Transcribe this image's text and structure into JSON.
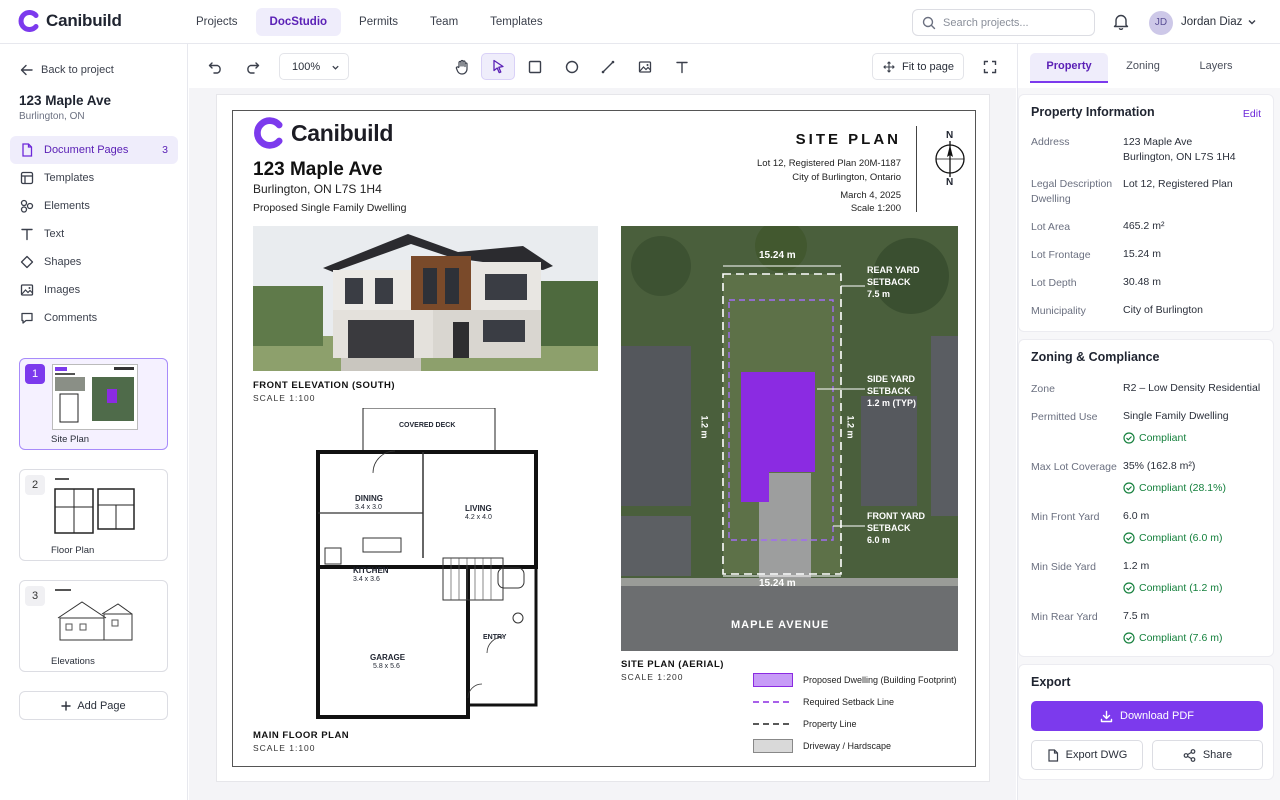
{
  "app": {
    "brand": "Canibuild"
  },
  "nav": {
    "items": [
      {
        "label": "Projects"
      },
      {
        "label": "DocStudio"
      },
      {
        "label": "Permits"
      },
      {
        "label": "Team"
      },
      {
        "label": "Templates"
      }
    ],
    "active": "DocStudio"
  },
  "search": {
    "placeholder": "Search projects..."
  },
  "user": {
    "initials": "JD",
    "name": "Jordan Diaz"
  },
  "sidebar": {
    "back_label": "Back to project",
    "project_title": "123 Maple Ave",
    "project_sub": "Burlington, ON",
    "menu": [
      {
        "label": "Document Pages",
        "count": "3",
        "icon": "document-icon"
      },
      {
        "label": "Templates",
        "icon": "template-icon"
      },
      {
        "label": "Elements",
        "icon": "elements-icon"
      },
      {
        "label": "Text",
        "icon": "text-icon"
      },
      {
        "label": "Shapes",
        "icon": "shapes-icon"
      },
      {
        "label": "Images",
        "icon": "image-icon"
      },
      {
        "label": "Comments",
        "icon": "comment-icon"
      }
    ],
    "pages": [
      {
        "num": "1",
        "label": "Site Plan"
      },
      {
        "num": "2",
        "label": "Floor Plan"
      },
      {
        "num": "3",
        "label": "Elevations"
      }
    ],
    "add_page": "Add Page"
  },
  "toolbar": {
    "zoom": "100%",
    "fit_label": "Fit to page",
    "tools": [
      "undo-icon",
      "redo-icon",
      "hand-icon",
      "select-icon",
      "rectangle-icon",
      "circle-icon",
      "line-icon",
      "image-icon",
      "text-icon",
      "fullscreen-icon"
    ]
  },
  "sheet": {
    "brand": "Canibuild",
    "address": "123 Maple Ave",
    "city": "Burlington, ON L7S 1H4",
    "desc": "Proposed Single Family Dwelling",
    "title": "SITE PLAN",
    "meta1": "Lot 12, Registered Plan 20M-1187",
    "meta2": "City of Burlington, Ontario",
    "date": "March 4, 2025",
    "scale": "Scale 1:200",
    "north": "N",
    "elev_caption": "FRONT ELEVATION (SOUTH)",
    "elev_scale": "SCALE 1:100",
    "floor_caption": "MAIN FLOOR PLAN",
    "floor_scale": "SCALE 1:100",
    "aerial_caption": "SITE PLAN (AERIAL)",
    "aerial_scale": "SCALE 1:200",
    "rooms": {
      "deck": "COVERED DECK",
      "dining": "DINING",
      "dining_dim": "3.4 x 3.0",
      "living": "LIVING",
      "living_dim": "4.2 x 4.0",
      "kitchen": "KITCHEN",
      "kitchen_dim": "3.4 x 3.6",
      "garage": "GARAGE",
      "garage_dim": "5.8 x 5.6",
      "entry": "ENTRY"
    },
    "aerial": {
      "frontage": "15.24 m",
      "frontage2": "15.24 m",
      "rear_l1": "REAR YARD",
      "rear_l2": "SETBACK",
      "rear_l3": "7.5 m",
      "side_l1": "SIDE YARD",
      "side_l2": "SETBACK",
      "side_l3": "1.2 m (TYP)",
      "front_l1": "FRONT YARD",
      "front_l2": "SETBACK",
      "front_l3": "6.0 m",
      "side_dim": "1.2 m",
      "street": "MAPLE AVENUE"
    },
    "legend": [
      {
        "label": "Proposed Dwelling (Building Footprint)"
      },
      {
        "label": "Required Setback Line"
      },
      {
        "label": "Property Line"
      },
      {
        "label": "Driveway / Hardscape"
      }
    ]
  },
  "right": {
    "tabs": [
      {
        "label": "Property"
      },
      {
        "label": "Zoning"
      },
      {
        "label": "Layers"
      }
    ],
    "property": {
      "title": "Property Information",
      "edit": "Edit",
      "rows": [
        {
          "label": "Address",
          "value": "123 Maple Ave",
          "value2": "Burlington, ON L7S 1H4"
        },
        {
          "label": "Legal Description",
          "label2": "Dwelling",
          "value": "Lot 12, Registered Plan"
        },
        {
          "label": "Lot Area",
          "value": "465.2 m²"
        },
        {
          "label": "Lot Frontage",
          "value": "15.24 m"
        },
        {
          "label": "Lot Depth",
          "value": "30.48 m"
        },
        {
          "label": "Municipality",
          "value": "City of Burlington"
        }
      ]
    },
    "zoning": {
      "title": "Zoning & Compliance",
      "rows": [
        {
          "label": "Zone",
          "value": "R2 – Low Density Residential"
        },
        {
          "label": "Permitted Use",
          "value": "Single Family Dwelling",
          "status": "Compliant"
        },
        {
          "label": "Max Lot Coverage",
          "value": "35% (162.8 m²)",
          "status": "Compliant (28.1%)"
        },
        {
          "label": "Min Front Yard",
          "value": "6.0 m",
          "status": "Compliant (6.0 m)"
        },
        {
          "label": "Min Side Yard",
          "value": "1.2 m",
          "status": "Compliant (1.2 m)"
        },
        {
          "label": "Min Rear Yard",
          "value": "7.5 m",
          "status": "Compliant (7.6 m)"
        }
      ]
    },
    "export": {
      "title": "Export",
      "pdf": "Download PDF",
      "dwg": "Export DWG",
      "share": "Share"
    }
  },
  "colors": {
    "accent": "#7c3aed",
    "accent_light": "#efedfb",
    "success": "#15803d",
    "footprint": "#8b2be2"
  }
}
